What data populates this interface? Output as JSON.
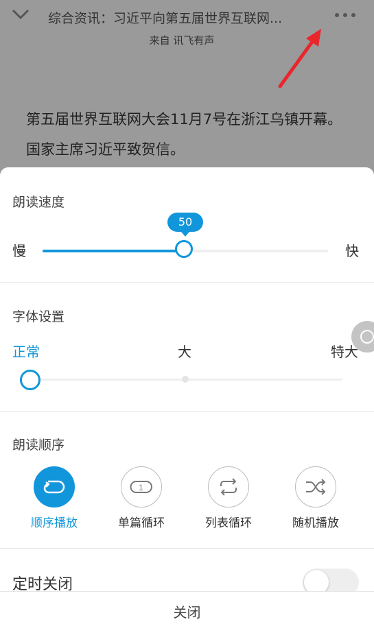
{
  "header": {
    "title": "综合资讯：习近平向第五届世界互联网...",
    "subtitle": "来自 讯飞有声"
  },
  "article": {
    "text": "第五届世界互联网大会11月7号在浙江乌镇开幕。国家主席习近平致贺信。"
  },
  "speed": {
    "title": "朗读速度",
    "slow_label": "慢",
    "fast_label": "快",
    "value": "50"
  },
  "font": {
    "title": "字体设置",
    "options": [
      "正常",
      "大",
      "特大"
    ],
    "selected_index": 0
  },
  "order": {
    "title": "朗读顺序",
    "items": [
      {
        "label": "顺序播放",
        "icon": "sequential-icon"
      },
      {
        "label": "单篇循环",
        "icon": "repeat-one-icon"
      },
      {
        "label": "列表循环",
        "icon": "repeat-list-icon"
      },
      {
        "label": "随机播放",
        "icon": "shuffle-icon"
      }
    ],
    "selected_index": 0
  },
  "timer": {
    "title": "定时关闭",
    "enabled": false
  },
  "footer": {
    "close_label": "关闭"
  },
  "colors": {
    "accent": "#1296db",
    "overlay": "#9a9a9a",
    "arrow": "#e8262c"
  }
}
